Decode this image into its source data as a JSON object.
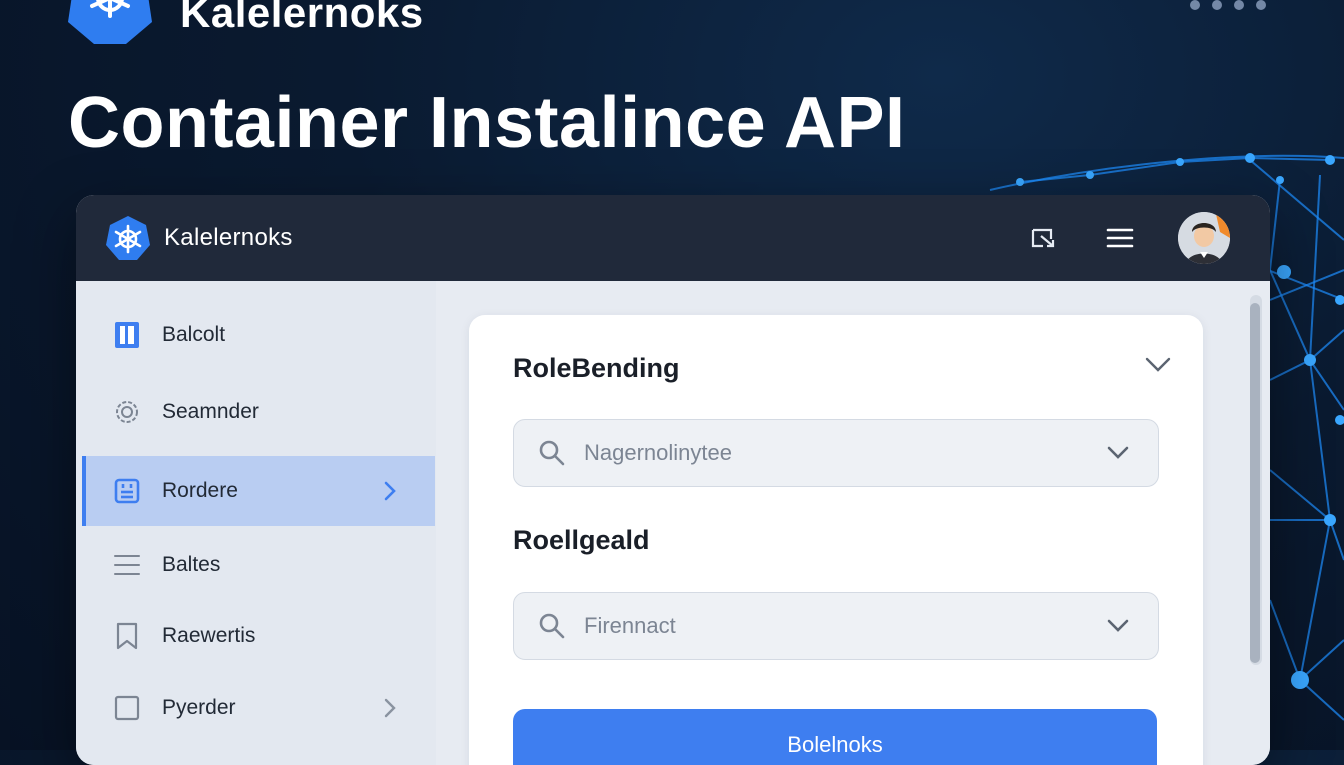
{
  "hero": {
    "brand_name": "Kalelernoks",
    "title": "Container Instalince API"
  },
  "topbar": {
    "app_name": "Kalelernoks",
    "icons": [
      "kubernetes-logo-icon",
      "external-window-icon",
      "hamburger-menu-icon",
      "user-avatar"
    ]
  },
  "sidebar": {
    "items": [
      {
        "label": "Balcolt",
        "icon": "book-icon",
        "active": false,
        "chevron": false
      },
      {
        "label": "Seamnder",
        "icon": "settings-gear-icon",
        "active": false,
        "chevron": false
      },
      {
        "label": "Rordere",
        "icon": "calendar-square-icon",
        "active": true,
        "chevron": true
      },
      {
        "label": "Baltes",
        "icon": "list-lines-icon",
        "active": false,
        "chevron": false
      },
      {
        "label": "Raewertis",
        "icon": "bookmark-icon",
        "active": false,
        "chevron": false
      },
      {
        "label": "Pyerder",
        "icon": "square-icon",
        "active": false,
        "chevron": true
      }
    ]
  },
  "form": {
    "section1_title": "RoleBending",
    "select1_placeholder": "Nagernolinytee",
    "section2_title": "Roellgeald",
    "select2_placeholder": "Firennact",
    "submit_label": "Bolelnoks"
  },
  "colors": {
    "accent": "#3e7ef0",
    "topbar": "#20293a",
    "sidebar": "#e3e8f0",
    "active_item": "#b9cdf2",
    "background": "#0a1a30",
    "network": "#1e8fff"
  }
}
